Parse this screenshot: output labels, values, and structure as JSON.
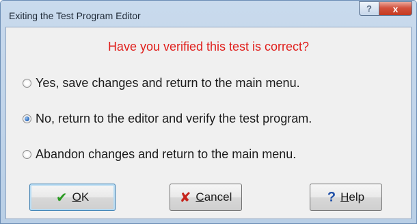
{
  "window": {
    "title": "Exiting the Test Program Editor",
    "caption_buttons": {
      "help": "?",
      "close": "x"
    }
  },
  "dialog": {
    "question": "Have you verified this test is correct?",
    "options": [
      {
        "label": "Yes, save changes and return to the main menu.",
        "selected": false
      },
      {
        "label": "No, return to the editor and verify the test program.",
        "selected": true
      },
      {
        "label": "Abandon changes and return to the main menu.",
        "selected": false
      }
    ]
  },
  "buttons": {
    "ok": {
      "mnemonic": "O",
      "rest": "K",
      "icon": "check-icon"
    },
    "cancel": {
      "mnemonic": "C",
      "rest": "ancel",
      "icon": "x-icon"
    },
    "help": {
      "mnemonic": "H",
      "rest": "elp",
      "icon": "question-icon"
    }
  },
  "colors": {
    "question": "#e0201d",
    "ok_icon": "#2a9a22",
    "cancel_icon": "#c6231b",
    "help_icon": "#1f4fa8"
  }
}
